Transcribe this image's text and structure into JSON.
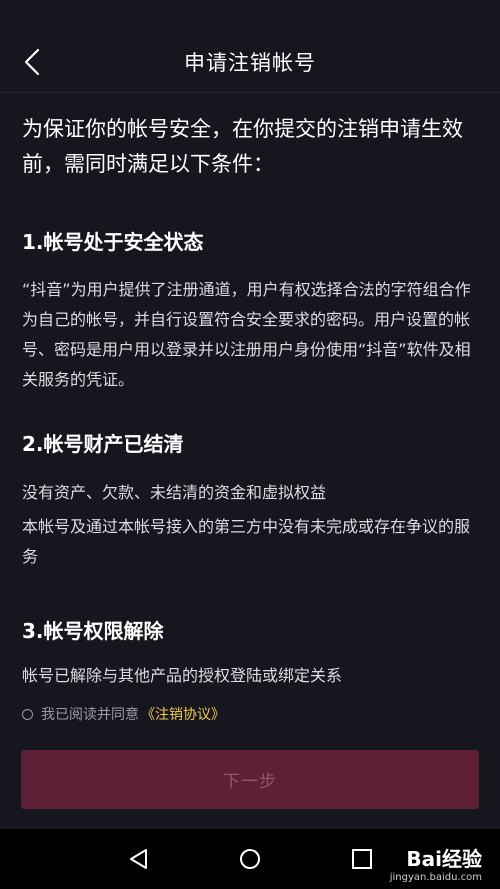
{
  "header": {
    "title": "申请注销帐号"
  },
  "intro": "为保证你的帐号安全，在你提交的注销申请生效前，需同时满足以下条件：",
  "sections": [
    {
      "title": "1.帐号处于安全状态",
      "paragraphs": [
        "“抖音”为用户提供了注册通道，用户有权选择合法的字符组合作为自己的帐号，并自行设置符合安全要求的密码。用户设置的帐号、密码是用户用以登录并以注册用户身份使用“抖音”软件及相关服务的凭证。"
      ]
    },
    {
      "title": "2.帐号财产已结清",
      "paragraphs": [
        "没有资产、欠款、未结清的资金和虚拟权益",
        "本帐号及通过本帐号接入的第三方中没有未完成或存在争议的服务"
      ]
    },
    {
      "title": "3.帐号权限解除",
      "paragraphs": [
        "帐号已解除与其他产品的授权登陆或绑定关系"
      ]
    }
  ],
  "agreement": {
    "text": "我已阅读并同意",
    "link": "《注销协议》",
    "checked": false
  },
  "next_button": {
    "label": "下一步"
  },
  "watermark": {
    "main": "Bai经验",
    "sub": "jingyan.baidu.com"
  },
  "colors": {
    "background": "#16161e",
    "button_disabled": "#5f1f36",
    "link": "#f2c94c"
  }
}
